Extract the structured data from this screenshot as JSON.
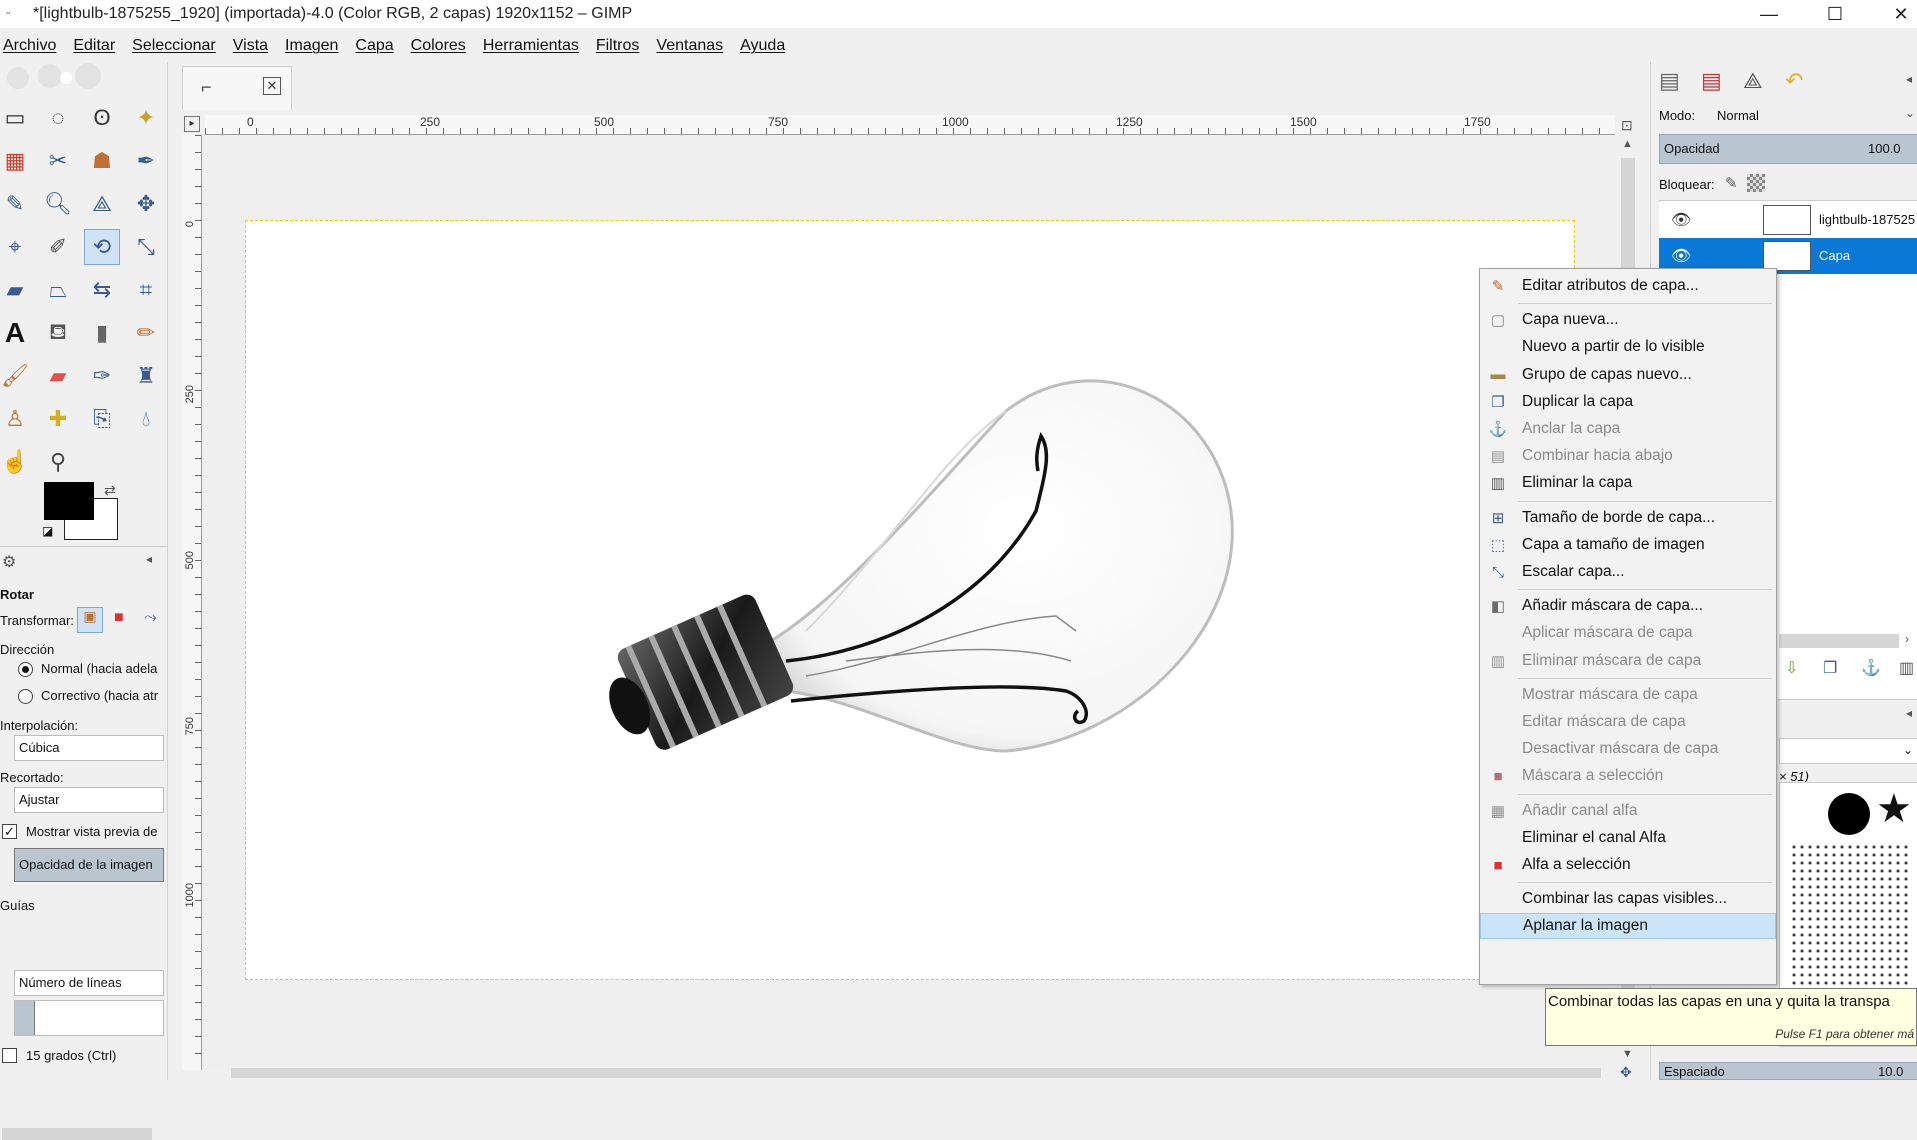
{
  "window": {
    "title": "*[lightbulb-1875255_1920] (importada)-4.0 (Color RGB, 2 capas) 1920x1152 – GIMP",
    "minimize": "—",
    "maximize": "☐",
    "close": "✕"
  },
  "menu": [
    "Archivo",
    "Editar",
    "Seleccionar",
    "Vista",
    "Imagen",
    "Capa",
    "Colores",
    "Herramientas",
    "Filtros",
    "Ventanas",
    "Ayuda"
  ],
  "ruler_top": [
    "0",
    "250",
    "500",
    "750",
    "1000",
    "1250",
    "1500",
    "1750"
  ],
  "ruler_left": [
    "0",
    "250",
    "500",
    "750",
    "1000"
  ],
  "tool_options": {
    "title": "Rotar",
    "transform_label": "Transformar:",
    "direction_label": "Dirección",
    "direction_normal": "Normal (hacia adela",
    "direction_corrective": "Correctivo (hacia atr",
    "interpolation_label": "Interpolación:",
    "interpolation_value": "Cúbica",
    "clipping_label": "Recortado:",
    "clipping_value": "Ajustar",
    "preview_label": "Mostrar vista previa de",
    "image_opacity": "Opacidad de la imagen",
    "guides_label": "Guías",
    "guides_value": "Número de líneas",
    "degrees_label": "15 grados  (Ctrl)"
  },
  "layers": {
    "mode_label": "Modo:",
    "mode_value": "Normal",
    "opacity_label": "Opacidad",
    "opacity_value": "100.0",
    "lock_label": "Bloquear:",
    "items": [
      {
        "name": "lightbulb-187525",
        "selected": false
      },
      {
        "name": "Capa",
        "selected": true
      }
    ]
  },
  "brushes": {
    "size_info": "× 51)",
    "spacing_label": "Espaciado",
    "spacing_value": "10.0"
  },
  "context_menu": [
    {
      "label": "Editar atributos de capa...",
      "icon": "edit-attributes-icon",
      "glyph": "✎",
      "color": "#c06030",
      "disabled": false
    },
    {
      "sep": true
    },
    {
      "label": "Capa nueva...",
      "icon": "new-layer-icon",
      "glyph": "▢",
      "color": "#888888",
      "disabled": false
    },
    {
      "label": "Nuevo a partir de lo visible",
      "icon": "",
      "glyph": "",
      "color": "",
      "disabled": false
    },
    {
      "label": "Grupo de capas nuevo...",
      "icon": "folder-icon",
      "glyph": "▬",
      "color": "#a08850",
      "disabled": false
    },
    {
      "label": "Duplicar la capa",
      "icon": "duplicate-layer-icon",
      "glyph": "❐",
      "color": "#3c5a8c",
      "disabled": false
    },
    {
      "label": "Anclar la capa",
      "icon": "anchor-icon",
      "glyph": "⚓",
      "color": "#909090",
      "disabled": true
    },
    {
      "label": "Combinar hacia abajo",
      "icon": "merge-down-icon",
      "glyph": "▤",
      "color": "#909090",
      "disabled": true
    },
    {
      "label": "Eliminar la capa",
      "icon": "delete-layer-icon",
      "glyph": "▥",
      "color": "#555555",
      "disabled": false
    },
    {
      "sep": true
    },
    {
      "label": "Tamaño de borde de capa...",
      "icon": "layer-boundary-icon",
      "glyph": "⊞",
      "color": "#3c5a8c",
      "disabled": false
    },
    {
      "label": "Capa a tamaño de imagen",
      "icon": "layer-to-image-size-icon",
      "glyph": "⬚",
      "color": "#3c5a8c",
      "disabled": false
    },
    {
      "label": "Escalar capa...",
      "icon": "scale-layer-icon",
      "glyph": "⤡",
      "color": "#3c5a8c",
      "disabled": false
    },
    {
      "sep": true
    },
    {
      "label": "Añadir máscara de capa...",
      "icon": "add-mask-icon",
      "glyph": "◧",
      "color": "#6a6a6a",
      "disabled": false
    },
    {
      "label": "Aplicar máscara de capa",
      "icon": "",
      "glyph": "",
      "color": "",
      "disabled": true
    },
    {
      "label": "Eliminar máscara de capa",
      "icon": "delete-mask-icon",
      "glyph": "▥",
      "color": "#909090",
      "disabled": true
    },
    {
      "sep": true
    },
    {
      "label": "Mostrar máscara de capa",
      "icon": "",
      "glyph": "",
      "color": "",
      "disabled": true
    },
    {
      "label": "Editar máscara de capa",
      "icon": "",
      "glyph": "",
      "color": "",
      "disabled": true
    },
    {
      "label": "Desactivar máscara de capa",
      "icon": "",
      "glyph": "",
      "color": "",
      "disabled": true
    },
    {
      "label": "Máscara a selección",
      "icon": "mask-to-selection-icon",
      "glyph": "■",
      "color": "#b07070",
      "disabled": true
    },
    {
      "sep": true
    },
    {
      "label": "Añadir canal alfa",
      "icon": "add-alpha-icon",
      "glyph": "▦",
      "color": "#909090",
      "disabled": true
    },
    {
      "label": "Eliminar el canal Alfa",
      "icon": "",
      "glyph": "",
      "color": "",
      "disabled": false
    },
    {
      "label": "Alfa a selección",
      "icon": "alpha-to-selection-icon",
      "glyph": "■",
      "color": "#e03030",
      "disabled": false
    },
    {
      "sep": true
    },
    {
      "label": "Combinar las capas visibles...",
      "icon": "",
      "glyph": "",
      "color": "",
      "disabled": false
    },
    {
      "label": "Aplanar la imagen",
      "icon": "",
      "glyph": "",
      "color": "",
      "disabled": false,
      "highlight": true
    }
  ],
  "tooltip": {
    "text": "Combinar todas las capas en una y quita la transpa",
    "hint": "Pulse F1 para obtener má"
  }
}
